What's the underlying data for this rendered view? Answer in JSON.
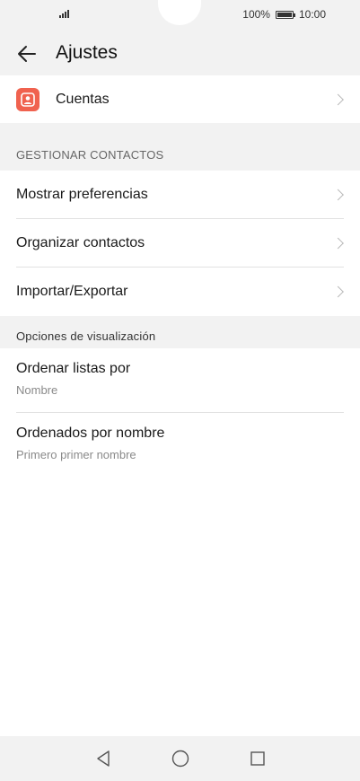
{
  "status_bar": {
    "battery_percent": "100%",
    "time": "10:00",
    "battery_level": 1.0
  },
  "header": {
    "title": "Ajustes",
    "back_icon": "arrow-left-icon"
  },
  "accounts": {
    "label": "Cuentas",
    "icon": "contact-account-icon",
    "icon_color": "#f0624f"
  },
  "manage_contacts": {
    "section_title": "GESTIONAR CONTACTOS",
    "items": [
      {
        "label": "Mostrar preferencias"
      },
      {
        "label": "Organizar contactos"
      },
      {
        "label": "Importar/Exportar"
      }
    ]
  },
  "display_options": {
    "section_title": "Opciones de visualización",
    "items": [
      {
        "title": "Ordenar listas por",
        "value": "Nombre"
      },
      {
        "title": "Ordenados por nombre",
        "value": "Primero primer nombre"
      }
    ]
  },
  "nav_bar": {
    "back": "triangle-back-icon",
    "home": "circle-home-icon",
    "recents": "square-recents-icon"
  }
}
